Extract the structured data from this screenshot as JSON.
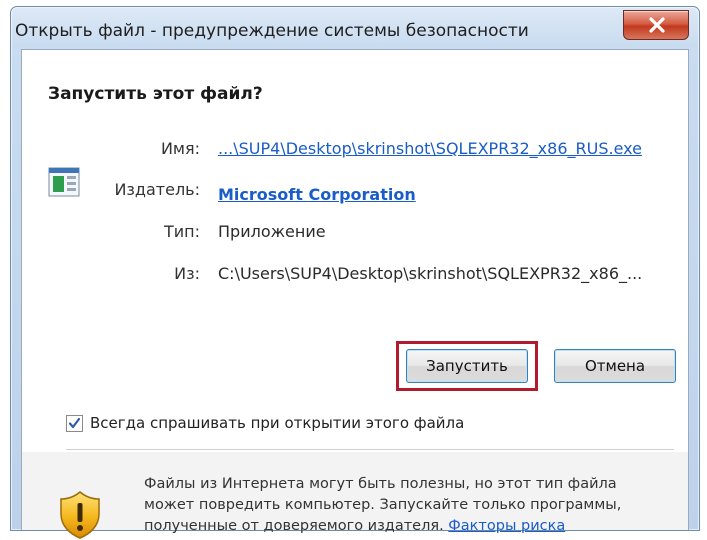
{
  "window": {
    "title": "Открыть файл - предупреждение системы безопасности"
  },
  "dialog": {
    "heading": "Запустить этот файл?",
    "fields": [
      {
        "label": "Имя:",
        "value": "...\\SUP4\\Desktop\\skrinshot\\SQLEXPR32_x86_RUS.exe"
      },
      {
        "label": "Издатель:",
        "value": "Microsoft Corporation"
      },
      {
        "label": "Тип:",
        "value": "Приложение"
      },
      {
        "label": "Из:",
        "value": "C:\\Users\\SUP4\\Desktop\\skrinshot\\SQLEXPR32_x86_..."
      }
    ],
    "run_label": "Запустить",
    "cancel_label": "Отмена",
    "always_ask_label": "Всегда спрашивать при открытии этого файла",
    "always_ask_checked": true
  },
  "footer": {
    "line1": "Файлы из Интернета могут быть полезны, но этот тип файла",
    "line2": "может повредить компьютер. Запускайте только программы,",
    "line3_text": "полученные от доверяемого издателя.",
    "risk_link": "Факторы риска"
  },
  "icons": {
    "close": "close-icon",
    "file": "application-file-icon",
    "shield": "security-shield-icon",
    "check": "checkmark-icon"
  },
  "colors": {
    "link": "#1a5cc8",
    "highlight_frame": "#b01c2e",
    "close_button": "#c1391e"
  }
}
